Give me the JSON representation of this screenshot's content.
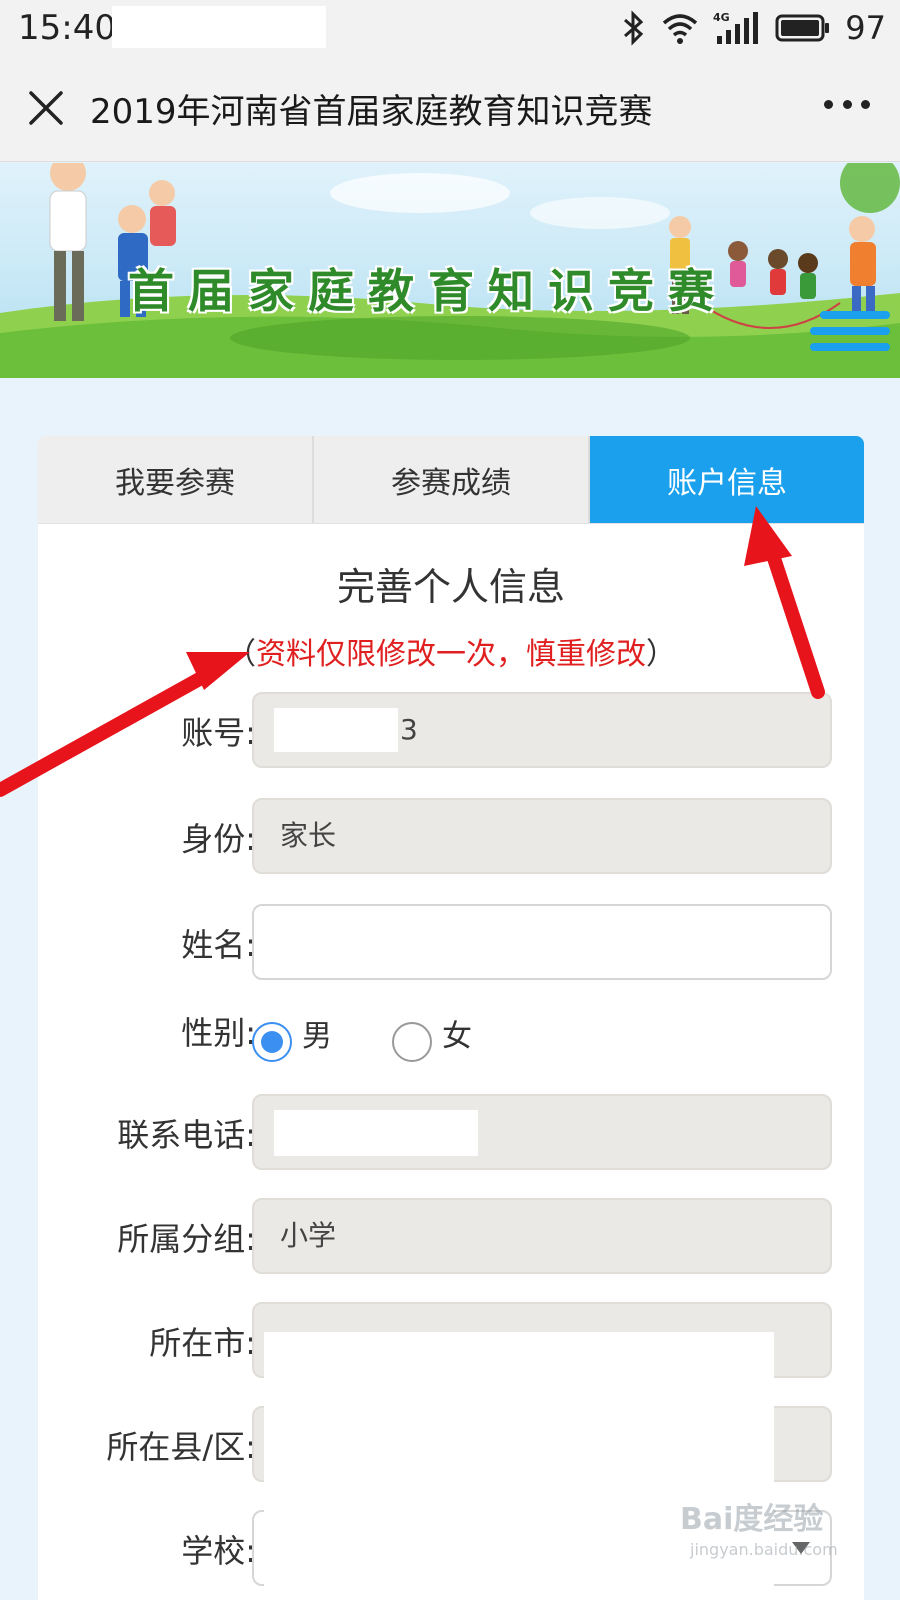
{
  "status_bar": {
    "time": "15:40",
    "network": "4G",
    "battery": "97"
  },
  "title_bar": {
    "title": "2019年河南省首届家庭教育知识竞赛"
  },
  "banner": {
    "title": "首届家庭教育知识竞赛"
  },
  "tabs": [
    {
      "label": "我要参赛",
      "active": false
    },
    {
      "label": "参赛成绩",
      "active": false
    },
    {
      "label": "账户信息",
      "active": true
    }
  ],
  "form": {
    "heading": "完善个人信息",
    "note_open": "（",
    "note_warning": "资料仅限修改一次，慎重修改",
    "note_close": "）",
    "fields": {
      "account": {
        "label": "账号:",
        "value": "3"
      },
      "identity": {
        "label": "身份:",
        "value": "家长"
      },
      "name": {
        "label": "姓名:",
        "value": ""
      },
      "gender": {
        "label": "性别:",
        "options": [
          "男",
          "女"
        ],
        "selected": "男"
      },
      "phone": {
        "label": "联系电话:",
        "value": ""
      },
      "group": {
        "label": "所属分组:",
        "value": "小学"
      },
      "city": {
        "label": "所在市:",
        "value": ""
      },
      "district": {
        "label": "所在县/区:",
        "value": ""
      },
      "school": {
        "label": "学校:",
        "value": ""
      }
    }
  },
  "watermark": {
    "text": "Bai度经验",
    "sub": "jingyan.baidu.com"
  },
  "colors": {
    "active_tab": "#1aa0ec",
    "warning_text": "#e02020",
    "radio_checked": "#3b8ff0",
    "annotation_arrow": "#e8141b"
  }
}
